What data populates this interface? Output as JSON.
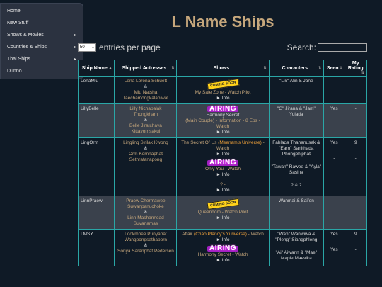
{
  "sidebar": {
    "items": [
      {
        "label": "Home",
        "arrow": ""
      },
      {
        "label": "New Stuff",
        "arrow": ""
      },
      {
        "label": "Shows & Movies",
        "arrow": "▸"
      },
      {
        "label": "Countries & Ships",
        "arrow": "▸"
      },
      {
        "label": "Thai Ships",
        "arrow": "▸"
      },
      {
        "label": "Dunno",
        "arrow": ""
      }
    ]
  },
  "page": {
    "title": "L Name Ships"
  },
  "controls": {
    "length_value": "50",
    "length_label": "entries per page",
    "search_label": "Search:",
    "search_value": ""
  },
  "table": {
    "headers": [
      "Ship Name",
      "Shipped Actresses",
      "Shows",
      "Characters",
      "Seen",
      "My Rating"
    ],
    "rows": [
      {
        "ship": "LenaMiu",
        "act1": "Lena Lorena Schuett",
        "amp": "&",
        "act2": "Miu Natsha Taechamongkalapiwat",
        "badge1": "COMING SOON",
        "show1": "My Safe Zone - Watch Pilot",
        "info1": "► Info",
        "chars": "\"Lin\" Alin & Jane",
        "seen": "-",
        "rating": "-"
      },
      {
        "ship": "LillyBelle",
        "act1": "Lilly Nichapalak Thongkham",
        "amp": "&",
        "act2": "Belle Jiratchaya Kittavornsakul",
        "badge1": "AIRING",
        "show1": "Harmony Secret",
        "show1b": "(Main Couple) - Information - 8 Eps - Watch",
        "info1": "► Info",
        "chars": "\"G\" Jirana & \"Jam\" Yolada",
        "seen": "Yes",
        "rating": "-"
      },
      {
        "ship": "LingOrm",
        "act1": "Lingling Sirilak Kwong",
        "amp": "&",
        "act2": "Orm Kornnaphat Sethratanapong",
        "show0a": "The Secret Of Us",
        "show0b": "(Meenam's Universe)",
        "show0c": " - Watch",
        "info0": "► Info",
        "badge1": "AIRING",
        "show1": "Only You - Watch",
        "info1": "► Info",
        "show2": "? -",
        "info2": "► Info",
        "chars": "Fahlada Thananusak & \"Earn\" Sanithada Phongphiphat",
        "chars2": "\"Tawan\" Rawee & \"Ayla\" Sasina",
        "chars3": "? & ?",
        "seen": "Yes",
        "seen2": "-",
        "seen3": "-",
        "rating": "9",
        "rating2": "-",
        "rating3": "-"
      },
      {
        "ship": "LinnPraew",
        "act1": "Praew Chermawee Suwanpanuchoke",
        "amp": "&",
        "act2": "Linn Mashannoad Suvanamas",
        "badge1": "COMING SOON",
        "show1": "Queendom - Watch Pilot",
        "info1": "► Info",
        "chars": "Wanmai & Saifon",
        "seen": "-",
        "rating": "-"
      },
      {
        "ship": "LMSY",
        "act1": "Lookmhee Punyapat Wangpongsathaporn",
        "amp": "&",
        "act2": "Sonya Saranphat Pedersen",
        "show0a": "Affair",
        "show0b": "(Chao Planoy's Yuriverse)",
        "show0c": " - Watch",
        "info0": "► Info",
        "badge1": "AIRING",
        "show1": "Harmony Secret - Watch",
        "info1": "► Info",
        "chars": "\"Wan\" Wanwiwa & \"Pleng\" Siangphleng",
        "chars2": "\"Ai\" Aiwarin & \"Mae\" Maple Maevika",
        "seen": "Yes",
        "seen2": "Yes",
        "rating": "9",
        "rating2": "-"
      }
    ]
  }
}
